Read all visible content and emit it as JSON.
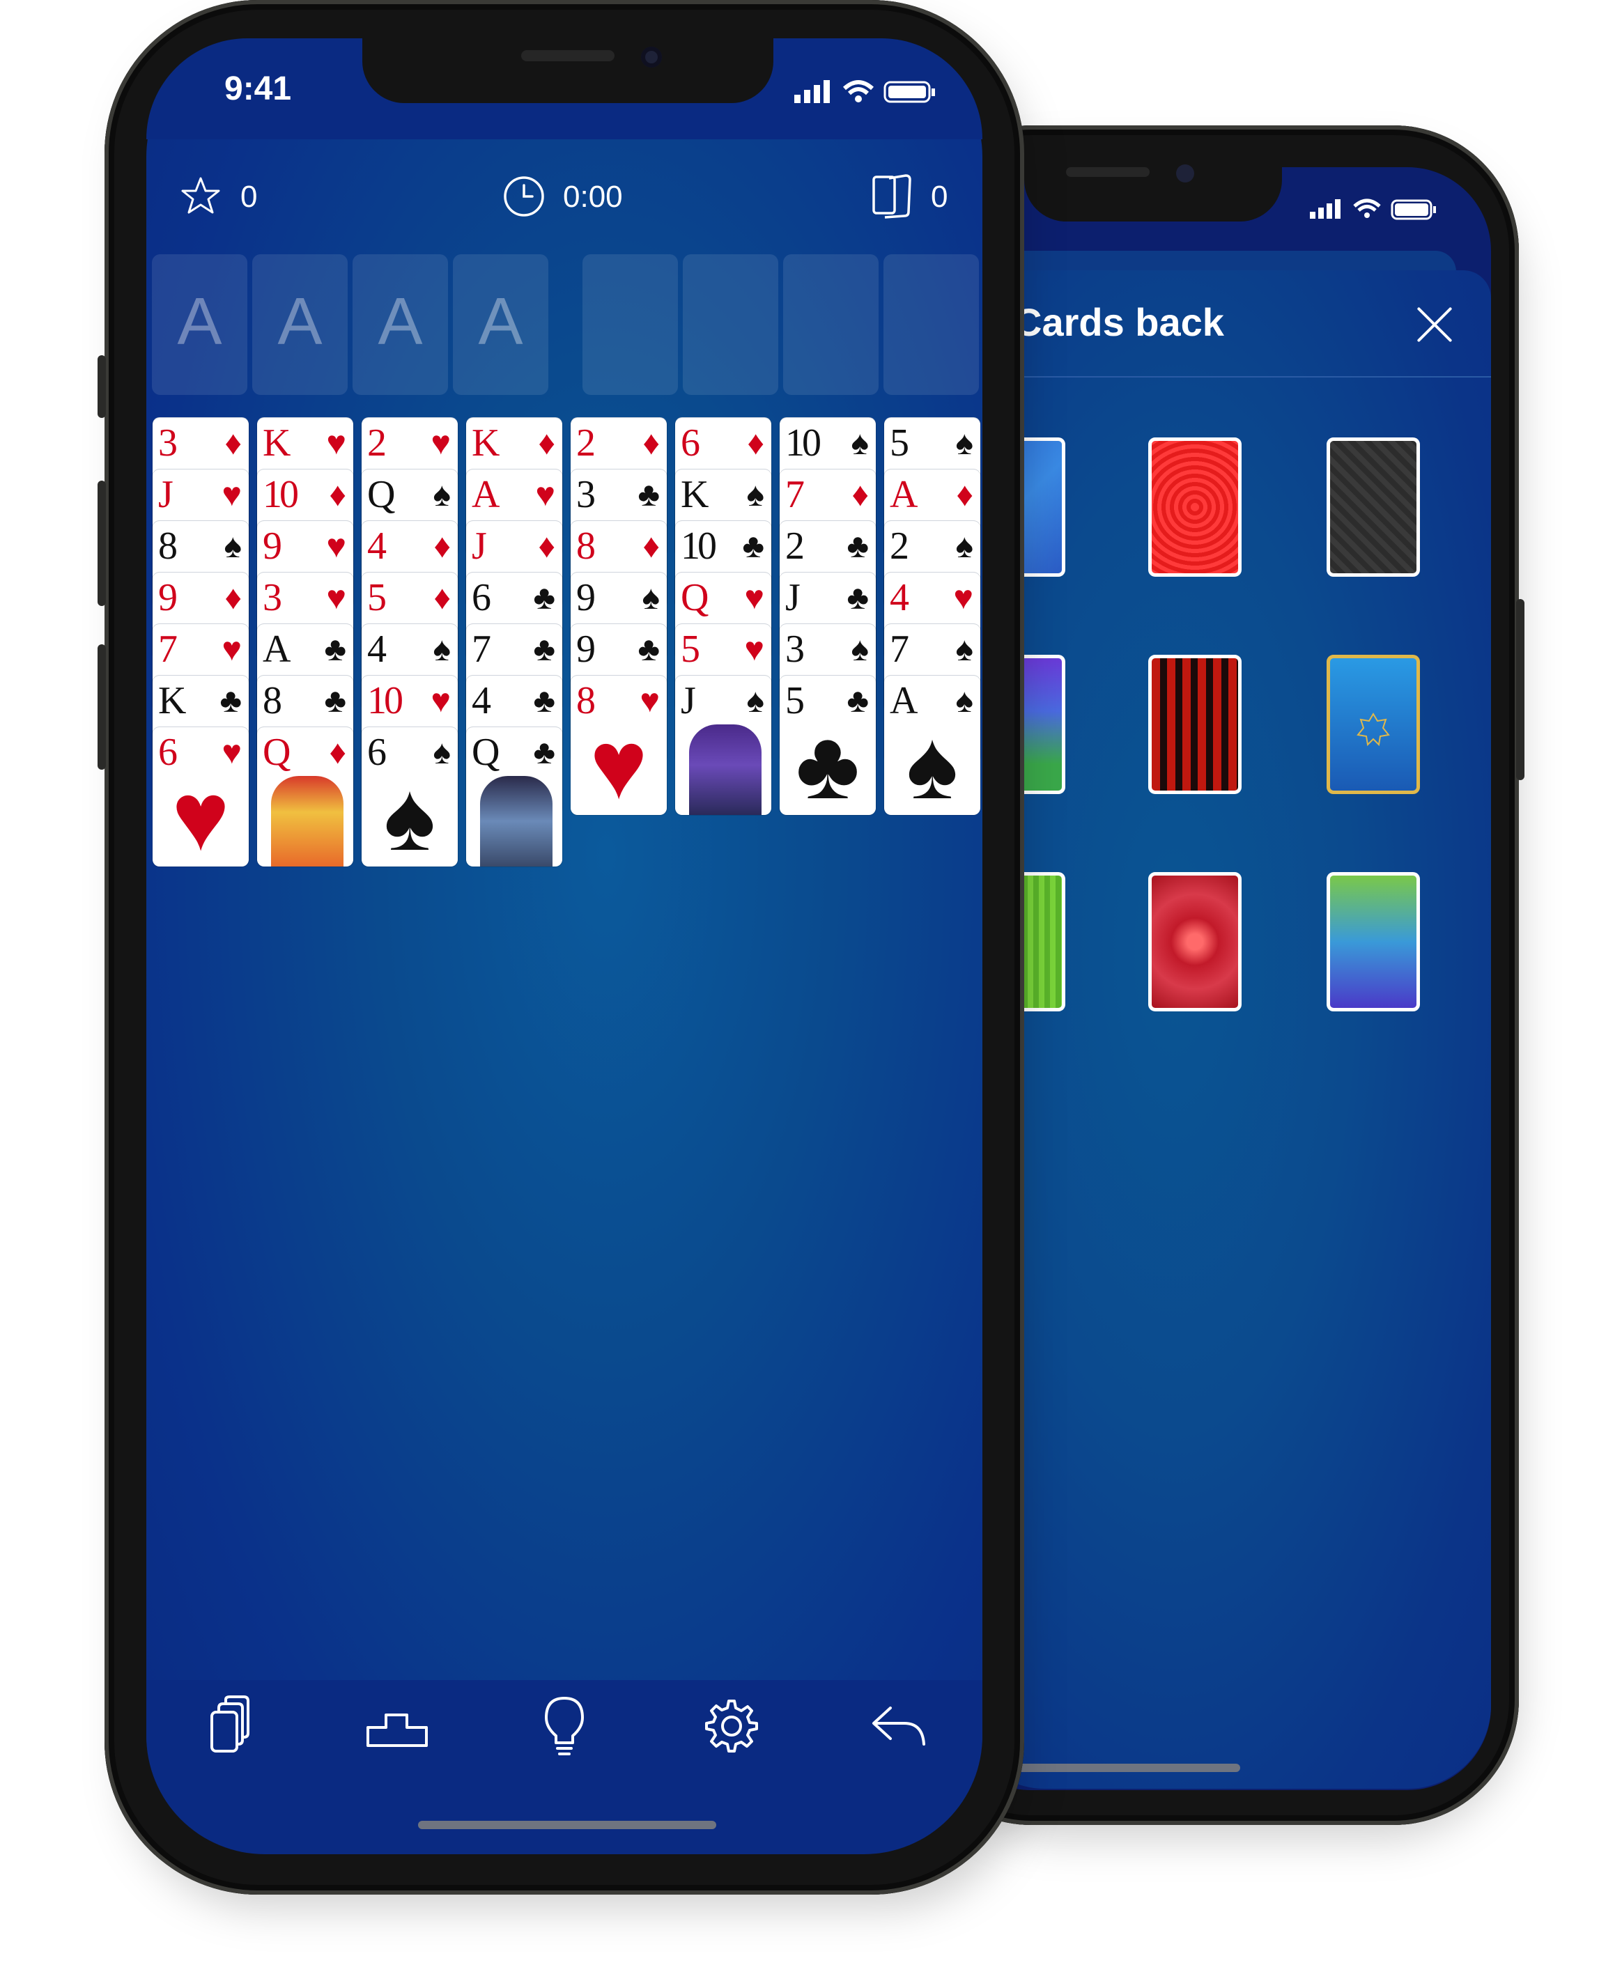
{
  "status": {
    "time": "9:41"
  },
  "toolbar": {
    "score": "0",
    "timer": "0:00",
    "moves": "0"
  },
  "foundation": {
    "labels": [
      "A",
      "A",
      "A",
      "A"
    ]
  },
  "tableau": [
    [
      {
        "rank": "3",
        "suit": "♦",
        "color": "red"
      },
      {
        "rank": "J",
        "suit": "♥",
        "color": "red"
      },
      {
        "rank": "8",
        "suit": "♠",
        "color": "blk"
      },
      {
        "rank": "9",
        "suit": "♦",
        "color": "red"
      },
      {
        "rank": "7",
        "suit": "♥",
        "color": "red"
      },
      {
        "rank": "K",
        "suit": "♣",
        "color": "blk"
      },
      {
        "rank": "6",
        "suit": "♥",
        "color": "red"
      }
    ],
    [
      {
        "rank": "K",
        "suit": "♥",
        "color": "red"
      },
      {
        "rank": "10",
        "suit": "♦",
        "color": "red"
      },
      {
        "rank": "9",
        "suit": "♥",
        "color": "red"
      },
      {
        "rank": "3",
        "suit": "♥",
        "color": "red"
      },
      {
        "rank": "A",
        "suit": "♣",
        "color": "blk"
      },
      {
        "rank": "8",
        "suit": "♣",
        "color": "blk"
      },
      {
        "rank": "Q",
        "suit": "♦",
        "color": "red"
      }
    ],
    [
      {
        "rank": "2",
        "suit": "♥",
        "color": "red"
      },
      {
        "rank": "Q",
        "suit": "♠",
        "color": "blk"
      },
      {
        "rank": "4",
        "suit": "♦",
        "color": "red"
      },
      {
        "rank": "5",
        "suit": "♦",
        "color": "red"
      },
      {
        "rank": "4",
        "suit": "♠",
        "color": "blk"
      },
      {
        "rank": "10",
        "suit": "♥",
        "color": "red"
      },
      {
        "rank": "6",
        "suit": "♠",
        "color": "blk"
      }
    ],
    [
      {
        "rank": "K",
        "suit": "♦",
        "color": "red"
      },
      {
        "rank": "A",
        "suit": "♥",
        "color": "red"
      },
      {
        "rank": "J",
        "suit": "♦",
        "color": "red"
      },
      {
        "rank": "6",
        "suit": "♣",
        "color": "blk"
      },
      {
        "rank": "7",
        "suit": "♣",
        "color": "blk"
      },
      {
        "rank": "4",
        "suit": "♣",
        "color": "blk"
      },
      {
        "rank": "Q",
        "suit": "♣",
        "color": "blk"
      }
    ],
    [
      {
        "rank": "2",
        "suit": "♦",
        "color": "red"
      },
      {
        "rank": "3",
        "suit": "♣",
        "color": "blk"
      },
      {
        "rank": "8",
        "suit": "♦",
        "color": "red"
      },
      {
        "rank": "9",
        "suit": "♠",
        "color": "blk"
      },
      {
        "rank": "9",
        "suit": "♣",
        "color": "blk"
      },
      {
        "rank": "8",
        "suit": "♥",
        "color": "red"
      }
    ],
    [
      {
        "rank": "6",
        "suit": "♦",
        "color": "red"
      },
      {
        "rank": "K",
        "suit": "♠",
        "color": "blk"
      },
      {
        "rank": "10",
        "suit": "♣",
        "color": "blk"
      },
      {
        "rank": "Q",
        "suit": "♥",
        "color": "red"
      },
      {
        "rank": "5",
        "suit": "♥",
        "color": "red"
      },
      {
        "rank": "J",
        "suit": "♠",
        "color": "blk"
      }
    ],
    [
      {
        "rank": "10",
        "suit": "♠",
        "color": "blk"
      },
      {
        "rank": "7",
        "suit": "♦",
        "color": "red"
      },
      {
        "rank": "2",
        "suit": "♣",
        "color": "blk"
      },
      {
        "rank": "J",
        "suit": "♣",
        "color": "blk"
      },
      {
        "rank": "3",
        "suit": "♠",
        "color": "blk"
      },
      {
        "rank": "5",
        "suit": "♣",
        "color": "blk"
      }
    ],
    [
      {
        "rank": "5",
        "suit": "♠",
        "color": "blk"
      },
      {
        "rank": "A",
        "suit": "♦",
        "color": "red"
      },
      {
        "rank": "2",
        "suit": "♠",
        "color": "blk"
      },
      {
        "rank": "4",
        "suit": "♥",
        "color": "red"
      },
      {
        "rank": "7",
        "suit": "♠",
        "color": "blk"
      },
      {
        "rank": "A",
        "suit": "♠",
        "color": "blk"
      }
    ]
  ],
  "bottom_nav": [
    "cards-icon",
    "podium-icon",
    "lightbulb-icon",
    "gear-icon",
    "undo-icon"
  ],
  "sheet": {
    "title": "Cards back",
    "backs": [
      "blue",
      "red-concentric",
      "dark-gray-pattern",
      "purple-green",
      "red-black-stripes",
      "blue-gold-star",
      "green-stripes",
      "red-ornate",
      "green-blue-gradient"
    ]
  },
  "colors": {
    "accent": "#0a2a82",
    "red": "#d0021b"
  }
}
